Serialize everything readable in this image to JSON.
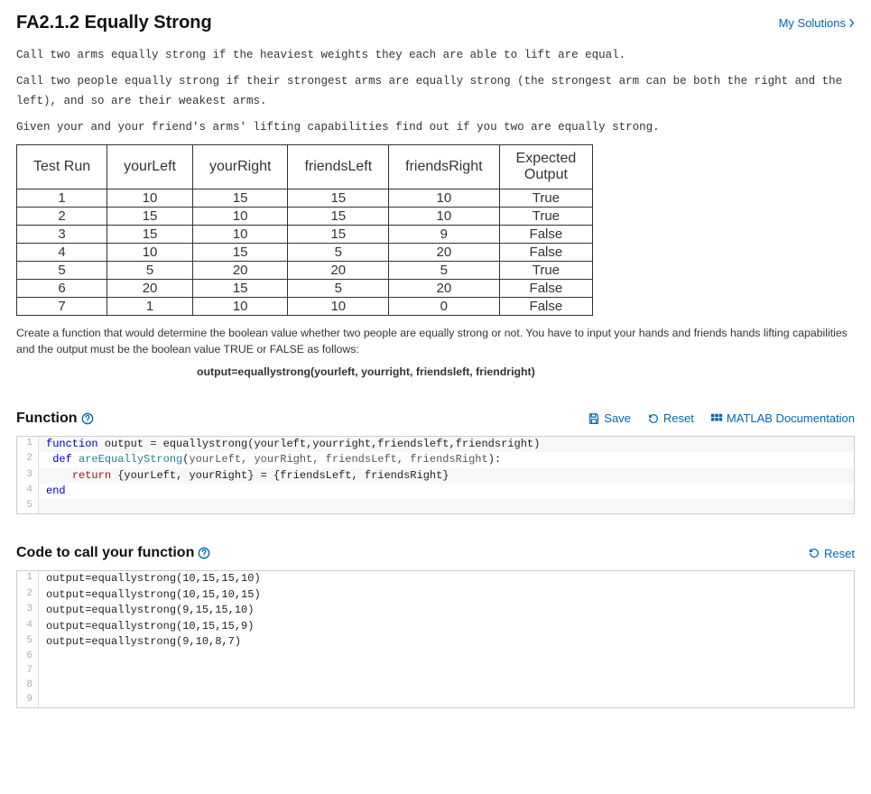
{
  "header": {
    "title": "FA2.1.2 Equally Strong",
    "my_solutions": "My Solutions"
  },
  "description": {
    "p1": "Call two arms equally strong if the heaviest weights they each are able to lift are equal.",
    "p2": "Call two people equally strong if their strongest arms are equally strong (the strongest arm can be both the right and the left), and so are their weakest arms.",
    "p3": "Given your and your friend's arms' lifting capabilities find out if you two are equally strong."
  },
  "table": {
    "columns": [
      "Test Run",
      "yourLeft",
      "yourRight",
      "friendsLeft",
      "friendsRight",
      "Expected Output"
    ],
    "rows": [
      [
        "1",
        "10",
        "15",
        "15",
        "10",
        "True"
      ],
      [
        "2",
        "15",
        "10",
        "15",
        "10",
        "True"
      ],
      [
        "3",
        "15",
        "10",
        "15",
        "9",
        "False"
      ],
      [
        "4",
        "10",
        "15",
        "5",
        "20",
        "False"
      ],
      [
        "5",
        "5",
        "20",
        "20",
        "5",
        "True"
      ],
      [
        "6",
        "20",
        "15",
        "5",
        "20",
        "False"
      ],
      [
        "7",
        "1",
        "10",
        "10",
        "0",
        "False"
      ]
    ]
  },
  "instructions": {
    "p1": "Create a function that would determine the boolean value whether two people are equally strong or not. You have to input your hands and friends hands lifting capabilities and the output must be the boolean value TRUE or FALSE as follows:",
    "signature": "output=equallystrong(yourleft, yourright, friendsleft, friendright)"
  },
  "function_section": {
    "title": "Function",
    "toolbar": {
      "save": "Save",
      "reset": "Reset",
      "docs": "MATLAB Documentation"
    },
    "lines": [
      {
        "n": "1",
        "seg": [
          {
            "c": "kw",
            "t": "function"
          },
          {
            "c": "",
            "t": " output = "
          },
          {
            "c": "",
            "t": "equallystrong(yourleft,yourright,friendsleft,friendsright)"
          }
        ],
        "hl": true
      },
      {
        "n": "2",
        "seg": [
          {
            "c": "",
            "t": " "
          },
          {
            "c": "kw",
            "t": "def"
          },
          {
            "c": "",
            "t": " "
          },
          {
            "c": "fn",
            "t": "areEquallyStrong"
          },
          {
            "c": "",
            "t": "("
          },
          {
            "c": "args",
            "t": "yourLeft, yourRight, friendsLeft, friendsRight"
          },
          {
            "c": "",
            "t": "):"
          }
        ],
        "hl": false
      },
      {
        "n": "3",
        "seg": [
          {
            "c": "",
            "t": "    "
          },
          {
            "c": "rkw",
            "t": "return"
          },
          {
            "c": "",
            "t": " {yourLeft, yourRight} = {friendsLeft, friendsRight}"
          }
        ],
        "hl": true
      },
      {
        "n": "4",
        "seg": [
          {
            "c": "kw",
            "t": "end"
          }
        ],
        "hl": false
      },
      {
        "n": "5",
        "seg": [
          {
            "c": "",
            "t": ""
          }
        ],
        "hl": true
      }
    ]
  },
  "call_section": {
    "title": "Code to call your function",
    "reset": "Reset",
    "lines": [
      {
        "n": "1",
        "t": "output=equallystrong(10,15,15,10)"
      },
      {
        "n": "2",
        "t": "output=equallystrong(10,15,10,15)"
      },
      {
        "n": "3",
        "t": "output=equallystrong(9,15,15,10)"
      },
      {
        "n": "4",
        "t": "output=equallystrong(10,15,15,9)"
      },
      {
        "n": "5",
        "t": "output=equallystrong(9,10,8,7)"
      },
      {
        "n": "6",
        "t": ""
      },
      {
        "n": "7",
        "t": ""
      },
      {
        "n": "8",
        "t": ""
      },
      {
        "n": "9",
        "t": ""
      }
    ]
  }
}
